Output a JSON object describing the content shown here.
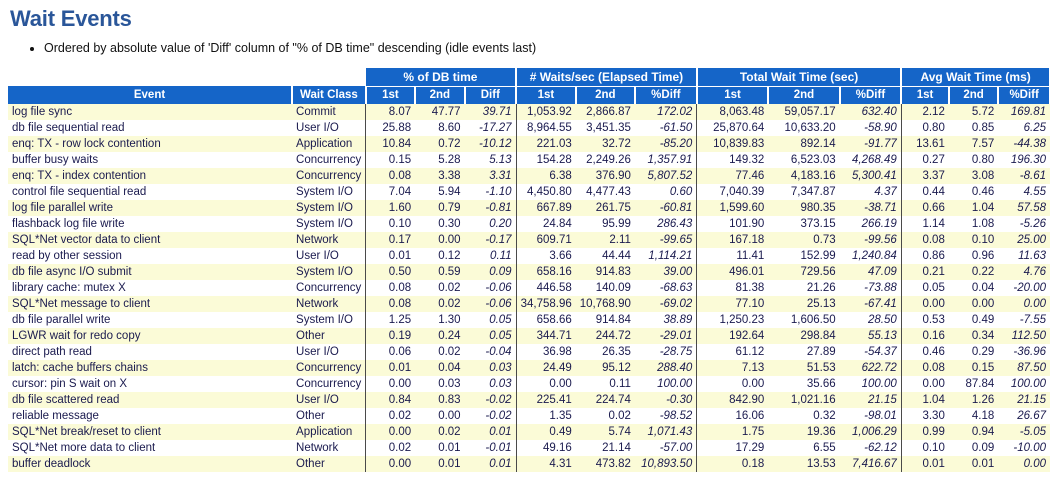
{
  "page": {
    "title": "Wait Events",
    "notes": [
      "Ordered by absolute value of 'Diff' column of \"% of DB time\" descending (idle events last)"
    ],
    "accent_color": "#1565c8",
    "title_color": "#2a5699",
    "alt_row_color": "#fbfbd7"
  },
  "table": {
    "group_headers": [
      "% of DB time",
      "# Waits/sec (Elapsed Time)",
      "Total Wait Time (sec)",
      "Avg Wait Time (ms)"
    ],
    "col_event": "Event",
    "col_wait_class": "Wait Class",
    "sub_headers": {
      "pct": [
        "1st",
        "2nd",
        "Diff"
      ],
      "waits": [
        "1st",
        "2nd",
        "%Diff"
      ],
      "total": [
        "1st",
        "2nd",
        "%Diff"
      ],
      "avg": [
        "1st",
        "2nd",
        "%Diff"
      ]
    },
    "rows": [
      {
        "event": "log file sync",
        "wait_class": "Commit",
        "pct": [
          "8.07",
          "47.77",
          "39.71"
        ],
        "waits": [
          "1,053.92",
          "2,866.87",
          "172.02"
        ],
        "total": [
          "8,063.48",
          "59,057.17",
          "632.40"
        ],
        "avg": [
          "2.12",
          "5.72",
          "169.81"
        ]
      },
      {
        "event": "db file sequential read",
        "wait_class": "User I/O",
        "pct": [
          "25.88",
          "8.60",
          "-17.27"
        ],
        "waits": [
          "8,964.55",
          "3,451.35",
          "-61.50"
        ],
        "total": [
          "25,870.64",
          "10,633.20",
          "-58.90"
        ],
        "avg": [
          "0.80",
          "0.85",
          "6.25"
        ]
      },
      {
        "event": "enq: TX - row lock contention",
        "wait_class": "Application",
        "pct": [
          "10.84",
          "0.72",
          "-10.12"
        ],
        "waits": [
          "221.03",
          "32.72",
          "-85.20"
        ],
        "total": [
          "10,839.83",
          "892.14",
          "-91.77"
        ],
        "avg": [
          "13.61",
          "7.57",
          "-44.38"
        ]
      },
      {
        "event": "buffer busy waits",
        "wait_class": "Concurrency",
        "pct": [
          "0.15",
          "5.28",
          "5.13"
        ],
        "waits": [
          "154.28",
          "2,249.26",
          "1,357.91"
        ],
        "total": [
          "149.32",
          "6,523.03",
          "4,268.49"
        ],
        "avg": [
          "0.27",
          "0.80",
          "196.30"
        ]
      },
      {
        "event": "enq: TX - index contention",
        "wait_class": "Concurrency",
        "pct": [
          "0.08",
          "3.38",
          "3.31"
        ],
        "waits": [
          "6.38",
          "376.90",
          "5,807.52"
        ],
        "total": [
          "77.46",
          "4,183.16",
          "5,300.41"
        ],
        "avg": [
          "3.37",
          "3.08",
          "-8.61"
        ]
      },
      {
        "event": "control file sequential read",
        "wait_class": "System I/O",
        "pct": [
          "7.04",
          "5.94",
          "-1.10"
        ],
        "waits": [
          "4,450.80",
          "4,477.43",
          "0.60"
        ],
        "total": [
          "7,040.39",
          "7,347.87",
          "4.37"
        ],
        "avg": [
          "0.44",
          "0.46",
          "4.55"
        ]
      },
      {
        "event": "log file parallel write",
        "wait_class": "System I/O",
        "pct": [
          "1.60",
          "0.79",
          "-0.81"
        ],
        "waits": [
          "667.89",
          "261.75",
          "-60.81"
        ],
        "total": [
          "1,599.60",
          "980.35",
          "-38.71"
        ],
        "avg": [
          "0.66",
          "1.04",
          "57.58"
        ]
      },
      {
        "event": "flashback log file write",
        "wait_class": "System I/O",
        "pct": [
          "0.10",
          "0.30",
          "0.20"
        ],
        "waits": [
          "24.84",
          "95.99",
          "286.43"
        ],
        "total": [
          "101.90",
          "373.15",
          "266.19"
        ],
        "avg": [
          "1.14",
          "1.08",
          "-5.26"
        ]
      },
      {
        "event": "SQL*Net vector data to client",
        "wait_class": "Network",
        "pct": [
          "0.17",
          "0.00",
          "-0.17"
        ],
        "waits": [
          "609.71",
          "2.11",
          "-99.65"
        ],
        "total": [
          "167.18",
          "0.73",
          "-99.56"
        ],
        "avg": [
          "0.08",
          "0.10",
          "25.00"
        ]
      },
      {
        "event": "read by other session",
        "wait_class": "User I/O",
        "pct": [
          "0.01",
          "0.12",
          "0.11"
        ],
        "waits": [
          "3.66",
          "44.44",
          "1,114.21"
        ],
        "total": [
          "11.41",
          "152.99",
          "1,240.84"
        ],
        "avg": [
          "0.86",
          "0.96",
          "11.63"
        ]
      },
      {
        "event": "db file async I/O submit",
        "wait_class": "System I/O",
        "pct": [
          "0.50",
          "0.59",
          "0.09"
        ],
        "waits": [
          "658.16",
          "914.83",
          "39.00"
        ],
        "total": [
          "496.01",
          "729.56",
          "47.09"
        ],
        "avg": [
          "0.21",
          "0.22",
          "4.76"
        ]
      },
      {
        "event": "library cache: mutex X",
        "wait_class": "Concurrency",
        "pct": [
          "0.08",
          "0.02",
          "-0.06"
        ],
        "waits": [
          "446.58",
          "140.09",
          "-68.63"
        ],
        "total": [
          "81.38",
          "21.26",
          "-73.88"
        ],
        "avg": [
          "0.05",
          "0.04",
          "-20.00"
        ]
      },
      {
        "event": "SQL*Net message to client",
        "wait_class": "Network",
        "pct": [
          "0.08",
          "0.02",
          "-0.06"
        ],
        "waits": [
          "34,758.96",
          "10,768.90",
          "-69.02"
        ],
        "total": [
          "77.10",
          "25.13",
          "-67.41"
        ],
        "avg": [
          "0.00",
          "0.00",
          "0.00"
        ]
      },
      {
        "event": "db file parallel write",
        "wait_class": "System I/O",
        "pct": [
          "1.25",
          "1.30",
          "0.05"
        ],
        "waits": [
          "658.66",
          "914.84",
          "38.89"
        ],
        "total": [
          "1,250.23",
          "1,606.50",
          "28.50"
        ],
        "avg": [
          "0.53",
          "0.49",
          "-7.55"
        ]
      },
      {
        "event": "LGWR wait for redo copy",
        "wait_class": "Other",
        "pct": [
          "0.19",
          "0.24",
          "0.05"
        ],
        "waits": [
          "344.71",
          "244.72",
          "-29.01"
        ],
        "total": [
          "192.64",
          "298.84",
          "55.13"
        ],
        "avg": [
          "0.16",
          "0.34",
          "112.50"
        ]
      },
      {
        "event": "direct path read",
        "wait_class": "User I/O",
        "pct": [
          "0.06",
          "0.02",
          "-0.04"
        ],
        "waits": [
          "36.98",
          "26.35",
          "-28.75"
        ],
        "total": [
          "61.12",
          "27.89",
          "-54.37"
        ],
        "avg": [
          "0.46",
          "0.29",
          "-36.96"
        ]
      },
      {
        "event": "latch: cache buffers chains",
        "wait_class": "Concurrency",
        "pct": [
          "0.01",
          "0.04",
          "0.03"
        ],
        "waits": [
          "24.49",
          "95.12",
          "288.40"
        ],
        "total": [
          "7.13",
          "51.53",
          "622.72"
        ],
        "avg": [
          "0.08",
          "0.15",
          "87.50"
        ]
      },
      {
        "event": "cursor: pin S wait on X",
        "wait_class": "Concurrency",
        "pct": [
          "0.00",
          "0.03",
          "0.03"
        ],
        "waits": [
          "0.00",
          "0.11",
          "100.00"
        ],
        "total": [
          "0.00",
          "35.66",
          "100.00"
        ],
        "avg": [
          "0.00",
          "87.84",
          "100.00"
        ]
      },
      {
        "event": "db file scattered read",
        "wait_class": "User I/O",
        "pct": [
          "0.84",
          "0.83",
          "-0.02"
        ],
        "waits": [
          "225.41",
          "224.74",
          "-0.30"
        ],
        "total": [
          "842.90",
          "1,021.16",
          "21.15"
        ],
        "avg": [
          "1.04",
          "1.26",
          "21.15"
        ]
      },
      {
        "event": "reliable message",
        "wait_class": "Other",
        "pct": [
          "0.02",
          "0.00",
          "-0.02"
        ],
        "waits": [
          "1.35",
          "0.02",
          "-98.52"
        ],
        "total": [
          "16.06",
          "0.32",
          "-98.01"
        ],
        "avg": [
          "3.30",
          "4.18",
          "26.67"
        ]
      },
      {
        "event": "SQL*Net break/reset to client",
        "wait_class": "Application",
        "pct": [
          "0.00",
          "0.02",
          "0.01"
        ],
        "waits": [
          "0.49",
          "5.74",
          "1,071.43"
        ],
        "total": [
          "1.75",
          "19.36",
          "1,006.29"
        ],
        "avg": [
          "0.99",
          "0.94",
          "-5.05"
        ]
      },
      {
        "event": "SQL*Net more data to client",
        "wait_class": "Network",
        "pct": [
          "0.02",
          "0.01",
          "-0.01"
        ],
        "waits": [
          "49.16",
          "21.14",
          "-57.00"
        ],
        "total": [
          "17.29",
          "6.55",
          "-62.12"
        ],
        "avg": [
          "0.10",
          "0.09",
          "-10.00"
        ]
      },
      {
        "event": "buffer deadlock",
        "wait_class": "Other",
        "pct": [
          "0.00",
          "0.01",
          "0.01"
        ],
        "waits": [
          "4.31",
          "473.82",
          "10,893.50"
        ],
        "total": [
          "0.18",
          "13.53",
          "7,416.67"
        ],
        "avg": [
          "0.01",
          "0.01",
          "0.00"
        ]
      }
    ]
  }
}
